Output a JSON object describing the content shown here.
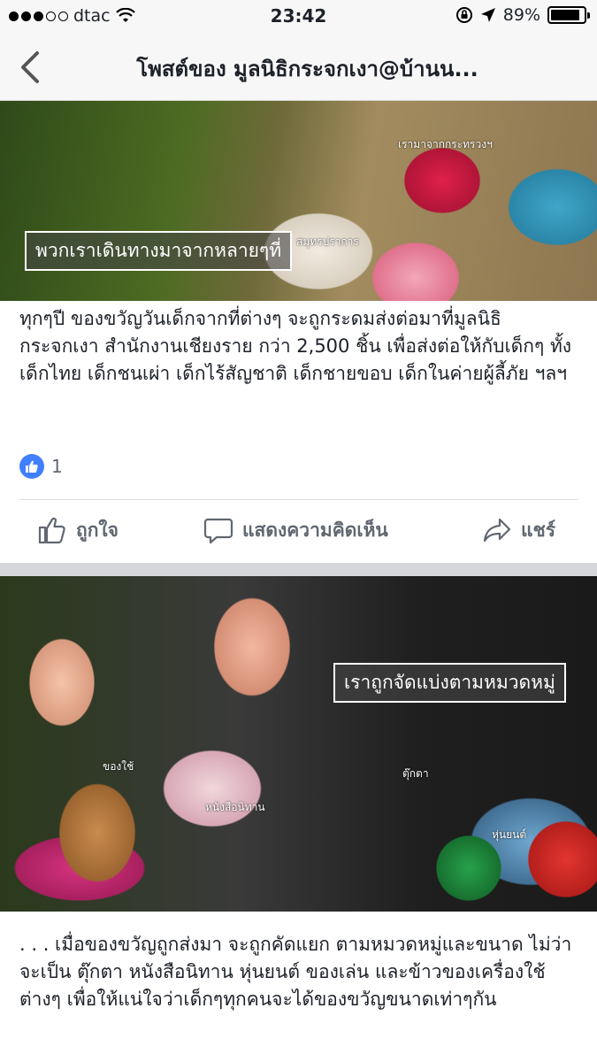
{
  "status_bar": {
    "carrier": "dtac",
    "time": "23:42",
    "battery": "89%",
    "battery_level": 0.89,
    "signal_bars_filled": 3,
    "signal_bars_total": 5
  },
  "nav": {
    "title": "โพสต์ของ มูลนิธิกระจกเงา@บ้านน..."
  },
  "posts": [
    {
      "image_labels": {
        "main": "พวกเราเดินทางมาจากหลายๆที่",
        "tag_a": "เรามาจากกระทรวงฯ",
        "tag_b": "สมุทรปราการ"
      },
      "text": "ทุกๆปี ของขวัญวันเด็กจากที่ต่างๆ จะถูกระดมส่งต่อมาที่มูลนิธิกระจกเงา สำนักงานเชียงราย กว่า 2,500 ชิ้น เพื่อส่งต่อให้กับเด็กๆ ทั้งเด็กไทย เด็กชนเผ่า เด็กไร้สัญชาติ เด็กชายขอบ เด็กในค่ายผู้ลี้ภัย ฯลฯ",
      "reaction_count": "1"
    },
    {
      "image_labels": {
        "main": "เราถูกจัดแบ่งตามหมวดหมู่",
        "tag_a": "ของใช้",
        "tag_b": "ตุ๊กตา",
        "tag_c": "หนังสือนิทาน",
        "tag_d": "หุ่นยนต์"
      },
      "text": ". . . เมื่อของขวัญถูกส่งมา จะถูกคัดแยก ตามหมวดหมู่และขนาด ไม่ว่าจะเป็น ตุ๊กตา หนังสือนิทาน หุ่นยนต์ ของเล่น และข้าวของเครื่องใช้ต่างๆ เพื่อให้แน่ใจว่าเด็กๆทุกคนจะได้ของขวัญขนาดเท่าๆกัน"
    }
  ],
  "actions": {
    "like": "ถูกใจ",
    "comment": "แสดงความคิดเห็น",
    "share": "แชร์"
  },
  "colors": {
    "accent": "#4080ff",
    "action_text": "#606770",
    "separator": "#d5d7db"
  }
}
